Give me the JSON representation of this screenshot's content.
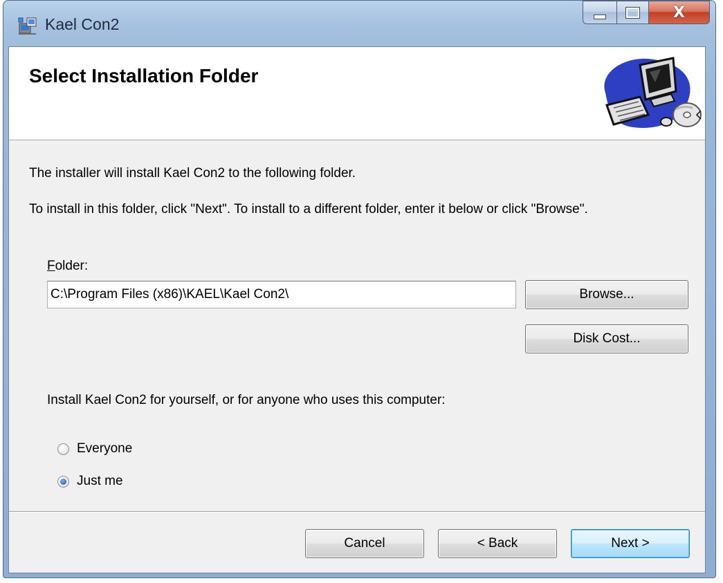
{
  "window": {
    "title": "Kael Con2",
    "caption_buttons": {
      "minimize_icon": "minimize-icon",
      "maximize_icon": "maximize-icon",
      "close_symbol": "X"
    }
  },
  "banner": {
    "title": "Select Installation Folder",
    "graphic_icon": "computer-setup-icon"
  },
  "intro": {
    "line1": "The installer will install Kael Con2 to the following folder.",
    "line2": "To install in this folder, click \"Next\". To install to a different folder, enter it below or click \"Browse\"."
  },
  "folder": {
    "label_mnemonic": "F",
    "label_rest": "older:",
    "value": "C:\\Program Files (x86)\\KAEL\\Kael Con2\\",
    "browse_label": "Browse...",
    "disk_cost_label": "Disk Cost..."
  },
  "install_for": {
    "prompt": "Install Kael Con2 for yourself, or for anyone who uses this computer:",
    "options": [
      {
        "label": "Everyone",
        "selected": false
      },
      {
        "label": "Just me",
        "selected": true
      }
    ]
  },
  "footer": {
    "cancel_label": "Cancel",
    "back_label": "< Back",
    "next_label": "Next >"
  },
  "colors": {
    "frame": "#a4c0df",
    "client_bg": "#f0f0f0",
    "default_button": "#bee6fd"
  }
}
